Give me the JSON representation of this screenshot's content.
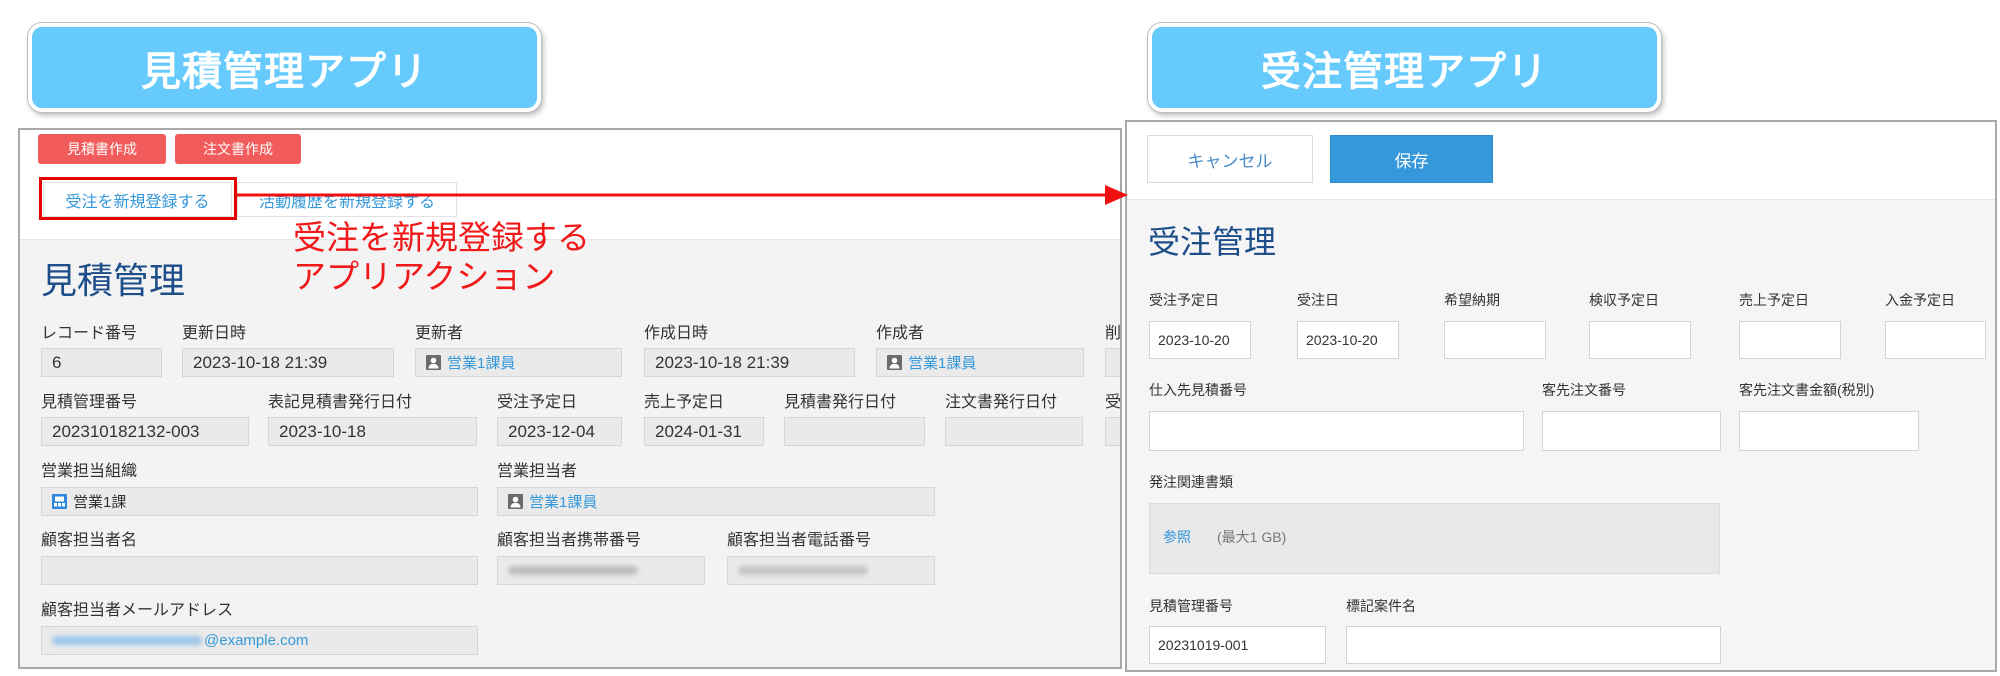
{
  "estimate_app": {
    "title": "見積管理アプリ",
    "toolbar": {
      "estimate_doc_button": "見積書作成",
      "order_doc_button": "注文書作成",
      "new_order_button": "受注を新規登録する",
      "new_activity_button": "活動履歴を新規登録する"
    },
    "heading": "見積管理",
    "fields": {
      "record_number": {
        "label": "レコード番号",
        "value": "6"
      },
      "updated_at": {
        "label": "更新日時",
        "value": "2023-10-18 21:39"
      },
      "updated_by": {
        "label": "更新者",
        "value": "営業1課員"
      },
      "created_at": {
        "label": "作成日時",
        "value": "2023-10-18 21:39"
      },
      "created_by": {
        "label": "作成者",
        "value": "営業1課員"
      },
      "cut_field_1": {
        "label": "削"
      },
      "estimate_number": {
        "label": "見積管理番号",
        "value": "202310182132-003"
      },
      "notation_issue_date": {
        "label": "表記見積書発行日付",
        "value": "2023-10-18"
      },
      "planned_order_date": {
        "label": "受注予定日",
        "value": "2023-12-04"
      },
      "planned_sales_date": {
        "label": "売上予定日",
        "value": "2024-01-31"
      },
      "estimate_issue_date": {
        "label": "見積書発行日付"
      },
      "order_doc_issue_date": {
        "label": "注文書発行日付"
      },
      "cut_field_2": {
        "label": "受"
      },
      "sales_org": {
        "label": "営業担当組織",
        "value": "営業1課"
      },
      "sales_rep": {
        "label": "営業担当者",
        "value": "営業1課員"
      },
      "customer_contact_name": {
        "label": "顧客担当者名"
      },
      "customer_contact_mobile": {
        "label": "顧客担当者携帯番号"
      },
      "customer_contact_phone": {
        "label": "顧客担当者電話番号"
      },
      "customer_contact_email": {
        "label": "顧客担当者メールアドレス",
        "value": "@example.com"
      }
    }
  },
  "annotation": {
    "line1": "受注を新規登録する",
    "line2": "アプリアクション"
  },
  "order_app": {
    "title": "受注管理アプリ",
    "toolbar": {
      "cancel_button": "キャンセル",
      "save_button": "保存"
    },
    "heading": "受注管理",
    "fields": {
      "planned_order_date": {
        "label": "受注予定日",
        "value": "2023-10-20"
      },
      "order_date": {
        "label": "受注日",
        "value": "2023-10-20"
      },
      "desired_delivery": {
        "label": "希望納期"
      },
      "planned_inspection_date": {
        "label": "検収予定日"
      },
      "planned_sales_date": {
        "label": "売上予定日"
      },
      "planned_payment_date": {
        "label": "入金予定日"
      },
      "supplier_estimate_number": {
        "label": "仕入先見積番号"
      },
      "customer_order_number": {
        "label": "客先注文番号"
      },
      "customer_order_amount": {
        "label": "客先注文書金額(税別)"
      },
      "order_documents": {
        "label": "発注関連書類",
        "browse_link": "参照",
        "size_limit": "(最大1 GB)"
      },
      "estimate_number": {
        "label": "見積管理番号",
        "value": "20231019-001"
      },
      "notation_project_name": {
        "label": "標記案件名"
      }
    }
  },
  "icons": {
    "user": "person-icon",
    "organization": "organization-icon",
    "arrow": "arrow-right-icon"
  },
  "colors": {
    "title_pill": "#66cbfc",
    "action_red": "#f25b5b",
    "link_blue": "#3498db",
    "save_blue": "#3498db",
    "heading_blue": "#1d4e89",
    "annotation_red": "#f01818"
  }
}
